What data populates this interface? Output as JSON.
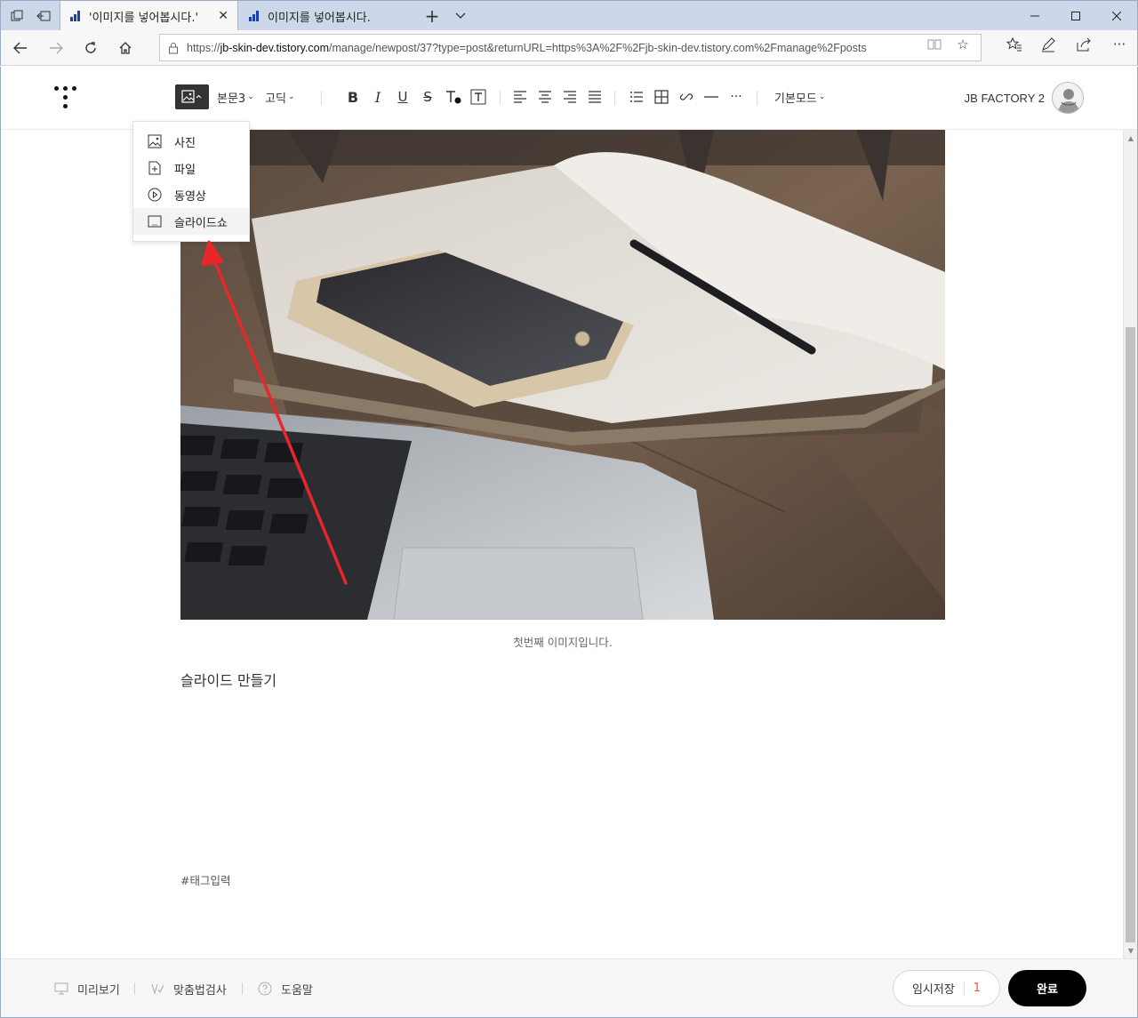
{
  "browser": {
    "tabs": [
      {
        "title": "'이미지를 넣어봅시다.'",
        "active": true
      },
      {
        "title": "이미지를 넣어봅시다.",
        "active": false
      }
    ],
    "url_prefix": "https://",
    "url_host": "jb-skin-dev.tistory.com",
    "url_path": "/manage/newpost/37?type=post&returnURL=https%3A%2F%2Fjb-skin-dev.tistory.com%2Fmanage%2Fposts"
  },
  "toolbar": {
    "paragraph_style": "본문3",
    "font": "고딕",
    "mode": "기본모드",
    "profile_name": "JB FACTORY 2"
  },
  "insert_menu": {
    "items": [
      {
        "label": "사진",
        "icon": "image-icon"
      },
      {
        "label": "파일",
        "icon": "file-add-icon"
      },
      {
        "label": "동영상",
        "icon": "play-circle-icon"
      },
      {
        "label": "슬라이드쇼",
        "icon": "slideshow-icon"
      }
    ],
    "hovered_index": 3
  },
  "content": {
    "caption": "첫번째 이미지입니다.",
    "body": "슬라이드 만들기",
    "tag_placeholder": "#태그입력"
  },
  "bottom_bar": {
    "preview": "미리보기",
    "spellcheck": "맞춤법검사",
    "help": "도움말",
    "save_draft": "임시저장",
    "draft_count": "1",
    "publish": "완료"
  },
  "colors": {
    "annotation_arrow": "#e8262b",
    "draft_count": "#f0542e",
    "tab_strip": "#ccd8ea"
  }
}
